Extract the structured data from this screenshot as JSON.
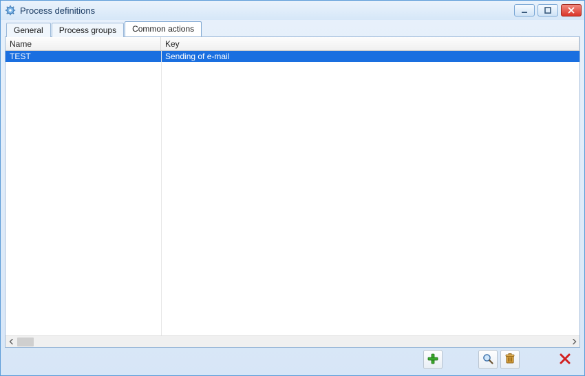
{
  "window": {
    "title": "Process definitions"
  },
  "tabs": [
    {
      "label": "General",
      "active": false
    },
    {
      "label": "Process groups",
      "active": false
    },
    {
      "label": "Common actions",
      "active": true
    }
  ],
  "table": {
    "columns": {
      "name": "Name",
      "key": "Key"
    },
    "rows": [
      {
        "name": "TEST",
        "key": "Sending of e-mail",
        "selected": true
      }
    ]
  },
  "icons": {
    "app": "gear-icon",
    "minimize": "minimize-icon",
    "maximize": "maximize-icon",
    "close": "close-icon",
    "add": "plus-icon",
    "search": "magnifier-icon",
    "delete": "trash-icon",
    "cancel": "x-red-icon",
    "scroll_left": "chevron-left-icon",
    "scroll_right": "chevron-right-icon"
  }
}
